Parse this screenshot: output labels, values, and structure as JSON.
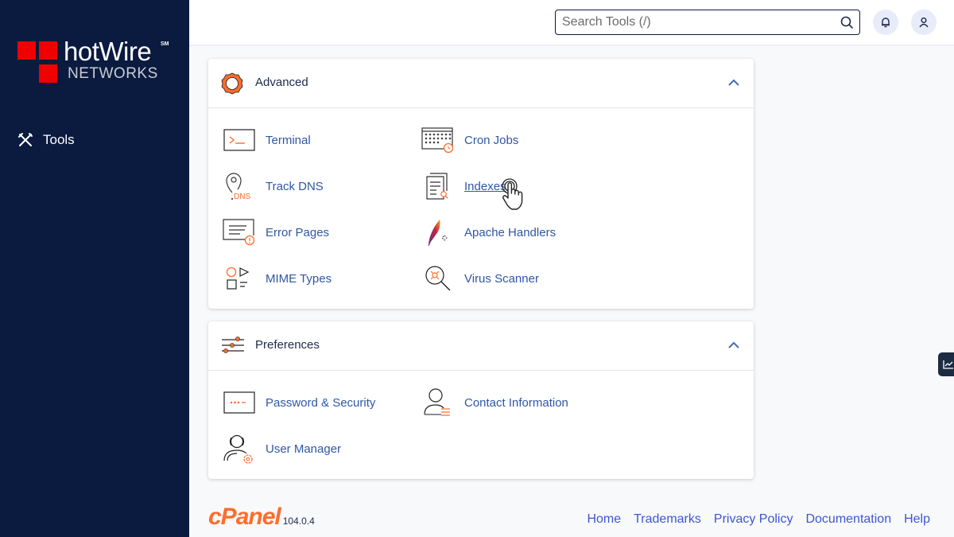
{
  "sidebar": {
    "logo": {
      "brand": "hotWire",
      "sm": "SM",
      "subtitle": "NETWORKS"
    },
    "nav": [
      {
        "label": "Tools",
        "icon": "tools-icon"
      }
    ]
  },
  "topbar": {
    "search_placeholder": "Search Tools (/)",
    "search_value": ""
  },
  "sections": [
    {
      "title": "Advanced",
      "icon": "gear-icon",
      "expanded": true,
      "items": [
        {
          "label": "Terminal",
          "icon": "terminal-icon"
        },
        {
          "label": "Cron Jobs",
          "icon": "cron-jobs-icon"
        },
        {
          "label": "Track DNS",
          "icon": "track-dns-icon",
          "icon_text": "DNS"
        },
        {
          "label": "Indexes",
          "icon": "indexes-icon",
          "hovered": true
        },
        {
          "label": "Error Pages",
          "icon": "error-pages-icon"
        },
        {
          "label": "Apache Handlers",
          "icon": "apache-feather-icon"
        },
        {
          "label": "MIME Types",
          "icon": "mime-types-icon"
        },
        {
          "label": "Virus Scanner",
          "icon": "virus-scanner-icon"
        }
      ]
    },
    {
      "title": "Preferences",
      "icon": "sliders-icon",
      "expanded": true,
      "items": [
        {
          "label": "Password & Security",
          "icon": "password-icon"
        },
        {
          "label": "Contact Information",
          "icon": "contact-info-icon"
        },
        {
          "label": "User Manager",
          "icon": "user-manager-icon"
        }
      ]
    }
  ],
  "footer": {
    "brand": "cPanel",
    "version": "104.0.4",
    "links": [
      "Home",
      "Trademarks",
      "Privacy Policy",
      "Documentation",
      "Help"
    ]
  },
  "colors": {
    "sidebar_bg": "#0b1a3f",
    "accent_orange": "#ff6c2c",
    "link_blue": "#2f57a4",
    "footer_link": "#3d55d6",
    "logo_red": "#f00000"
  }
}
